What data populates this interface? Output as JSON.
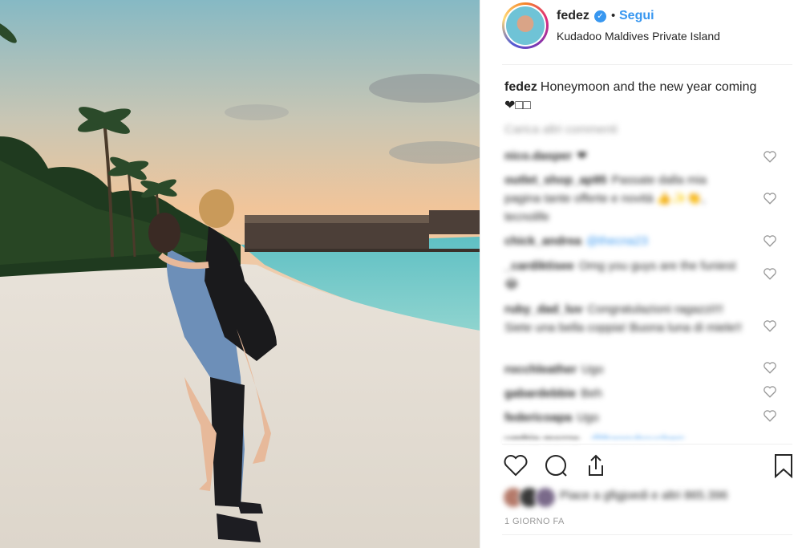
{
  "post": {
    "username": "fedez",
    "follow_label": "Segui",
    "location": "Kudadoo Maldives Private Island",
    "caption_user": "fedez",
    "caption_text": "Honeymoon and the new year coming ❤︎□□",
    "load_more": "Carica altri commenti",
    "comments": [
      {
        "user": "nico.dasper",
        "text": "❤"
      },
      {
        "user": "outlet_shop_ap95",
        "text": "Passate dalla mia pagina tante offerte e novità 👍✨👏, tecnolife"
      },
      {
        "user": "chick_andrea",
        "text": "",
        "mention": "@thecna23"
      },
      {
        "user": "_cardiktisee",
        "text": "Omg you guys are the funiest😂"
      },
      {
        "user": "ruby_dad_luv",
        "text": "Congratulazioni ragazzi!!! Siete una bella coppia! Buona luna di miele!!"
      },
      {
        "user": "rocchleather",
        "text": "Ugo"
      },
      {
        "user": "gabardebbie",
        "text": "Beh"
      },
      {
        "user": "federicoapa",
        "text": "Ugo"
      },
      {
        "user": "umbie.mazze_",
        "text": "",
        "mention": "@frannyboucherr"
      }
    ],
    "likes_text": "Piace a gfigjoedi e altri 865.396",
    "timestamp": "1 GIORNO FA"
  },
  "icons": {
    "verified": "verified-badge-icon",
    "like": "heart-icon",
    "comment": "comment-bubble-icon",
    "share": "share-icon",
    "save": "bookmark-icon"
  },
  "colors": {
    "link": "#3897f0",
    "text": "#262626",
    "muted": "#999999",
    "border": "#efefef"
  }
}
